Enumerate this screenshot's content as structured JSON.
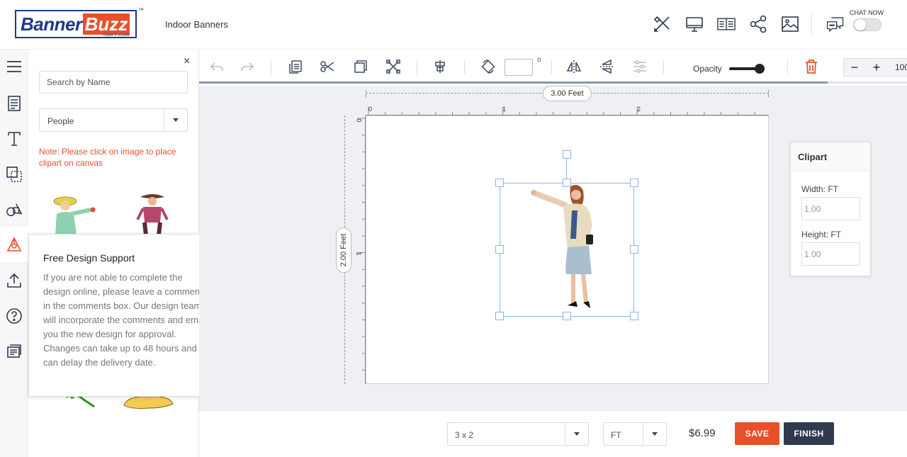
{
  "header": {
    "logo_part1": "Banner",
    "logo_part2": "Buzz",
    "logo_tm": "™",
    "logo_tagline": "make it visible",
    "product": "Indoor Banners",
    "chat_now": "CHAT NOW",
    "icons": [
      "design-tools-icon",
      "monitor-preview-icon",
      "book-info-icon",
      "share-icon",
      "image-icon",
      "chat-icon"
    ]
  },
  "sidebar": {
    "icons": [
      "menu-icon",
      "template-icon",
      "text-icon",
      "layers-icon",
      "shapes-icon",
      "clipart-icon",
      "upload-icon",
      "help-icon",
      "comments-icon"
    ],
    "active": "clipart-icon"
  },
  "clipart_panel": {
    "close": "×",
    "search_placeholder": "Search by Name",
    "category": "People",
    "note": "Note: Please click on image to place clipart on canvas"
  },
  "support_popup": {
    "title": "Free Design Support",
    "close": "×",
    "body": "If you are not able to complete the design online, please leave a comments in the comments box. Our design team will incorporate the comments and email you the new design for approval. Changes can take up to 48 hours and can delay the delivery date."
  },
  "toolbar": {
    "icons": [
      "undo-icon",
      "redo-icon",
      "copy-icon",
      "cut-icon",
      "duplicate-icon",
      "delete-element-icon",
      "align-center-icon",
      "rotate-icon",
      "flip-horizontal-icon",
      "flip-vertical-icon",
      "adjust-icon",
      "trash-icon"
    ],
    "rotation_value": "",
    "degree_symbol": "o",
    "opacity_label": "Opacity",
    "opacity_value": 1.0,
    "zoom_minus": "−",
    "zoom_plus": "+",
    "zoom_value": "100"
  },
  "canvas": {
    "width_label": "3.00 Feet",
    "height_label": "2.00 Feet",
    "ruler_h": [
      "0",
      "1",
      "2"
    ],
    "ruler_v": [
      "0",
      "1"
    ]
  },
  "properties": {
    "title": "Clipart",
    "width_label": "Width: FT",
    "width_value": "1.00",
    "height_label": "Height: FT",
    "height_value": "1.00"
  },
  "bottom": {
    "size": "3 x 2",
    "unit": "FT",
    "price": "$6.99",
    "save": "SAVE",
    "finish": "FINISH"
  },
  "colors": {
    "accent": "#e8502a",
    "brand_blue": "#1f3a8a",
    "finish_bg": "#2f3a4e",
    "selection": "#8fb3ee"
  }
}
